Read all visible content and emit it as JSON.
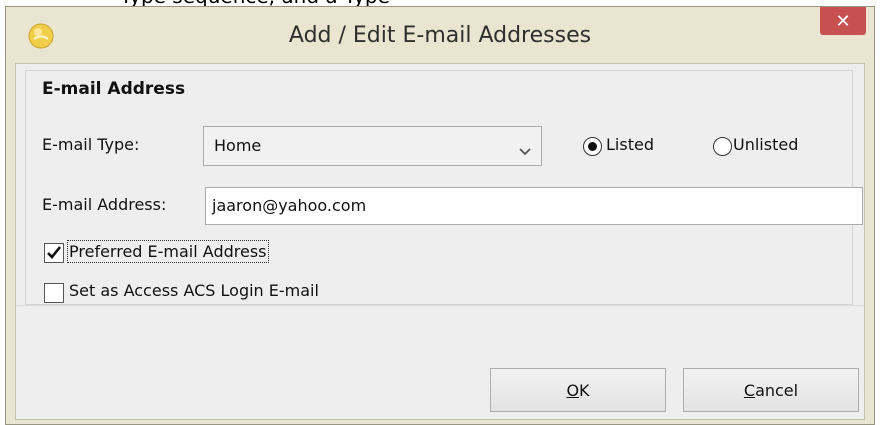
{
  "background_text": "Type sequence, and a Type",
  "window": {
    "title": "Add / Edit E-mail Addresses",
    "close_glyph": "✕"
  },
  "group": {
    "title": "E-mail Address"
  },
  "email_type": {
    "label": "E-mail Type:",
    "selected": "Home"
  },
  "listing": {
    "options": [
      {
        "label": "Listed",
        "selected": true
      },
      {
        "label": "Unlisted",
        "selected": false
      }
    ]
  },
  "email_address": {
    "label": "E-mail Address:",
    "value": "jaaron@yahoo.com"
  },
  "checkboxes": [
    {
      "label": "Preferred E-mail Address",
      "checked": true
    },
    {
      "label": "Set as Access ACS Login E-mail",
      "checked": false
    }
  ],
  "buttons": {
    "ok_mnemonic": "O",
    "ok_rest": "K",
    "cancel_mnemonic": "C",
    "cancel_rest": "ancel"
  },
  "icons": {
    "app": "app-logo-icon",
    "close": "close-icon",
    "dropdown": "chevron-down-icon",
    "check": "checkmark-icon"
  },
  "colors": {
    "close_button": "#c75050",
    "window_frame": "#e9e5d4",
    "client_area": "#eeeeee"
  }
}
